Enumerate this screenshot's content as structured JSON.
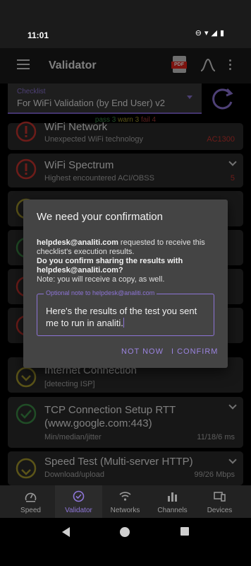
{
  "status": {
    "time": "11:01"
  },
  "app": {
    "title": "Validator"
  },
  "checklist": {
    "label": "Checklist",
    "value": "For WiFi Validation (by End User) v2",
    "summary_pass": "pass 3",
    "summary_warn": "warn 3",
    "summary_fail": "fail 4"
  },
  "cards": [
    {
      "title": "WiFi Network",
      "subtitle": "Unexpected WiFi technology",
      "value": "AC1300",
      "status": "fail"
    },
    {
      "title": "WiFi Spectrum",
      "subtitle": "Highest encountered ACI/OBSS",
      "value": "5",
      "status": "fail"
    },
    {
      "title": "Internet Connection",
      "subtitle": "[detecting ISP]",
      "value": "",
      "status": "warn"
    },
    {
      "title": "TCP Connection Setup RTT (www.google.com:443)",
      "subtitle": "Min/median/jitter",
      "value": "11/18/6 ms",
      "status": "pass"
    },
    {
      "title": "Speed Test (Multi-server HTTP)",
      "subtitle": "Download/upload",
      "value": "99/26 Mbps",
      "status": "warn"
    }
  ],
  "dialog": {
    "title": "We need your confirmation",
    "requester": "helpdesk@analiti.com",
    "requested_text": " requested to receive this checklist's execution results.",
    "question": "Do you confirm sharing the results with helpdesk@analiti.com?",
    "note": "Note: you will receive a copy, as well.",
    "note_label": "Optional note to helpdesk@analiti.com",
    "note_value": "Here's the results of the test you sent me to run in analiti.",
    "cancel_label": "NOT NOW",
    "confirm_label": "I CONFIRM"
  },
  "nav": {
    "items": [
      {
        "label": "Speed",
        "icon": "speedometer-icon"
      },
      {
        "label": "Validator",
        "icon": "check-circle-icon"
      },
      {
        "label": "Networks",
        "icon": "wifi-icon"
      },
      {
        "label": "Channels",
        "icon": "bar-chart-icon"
      },
      {
        "label": "Devices",
        "icon": "devices-icon"
      }
    ],
    "active": "Validator"
  },
  "colors": {
    "accent": "#8e76d8",
    "pass": "#3b8a45",
    "warn": "#a79a2d",
    "fail": "#c6342f"
  }
}
